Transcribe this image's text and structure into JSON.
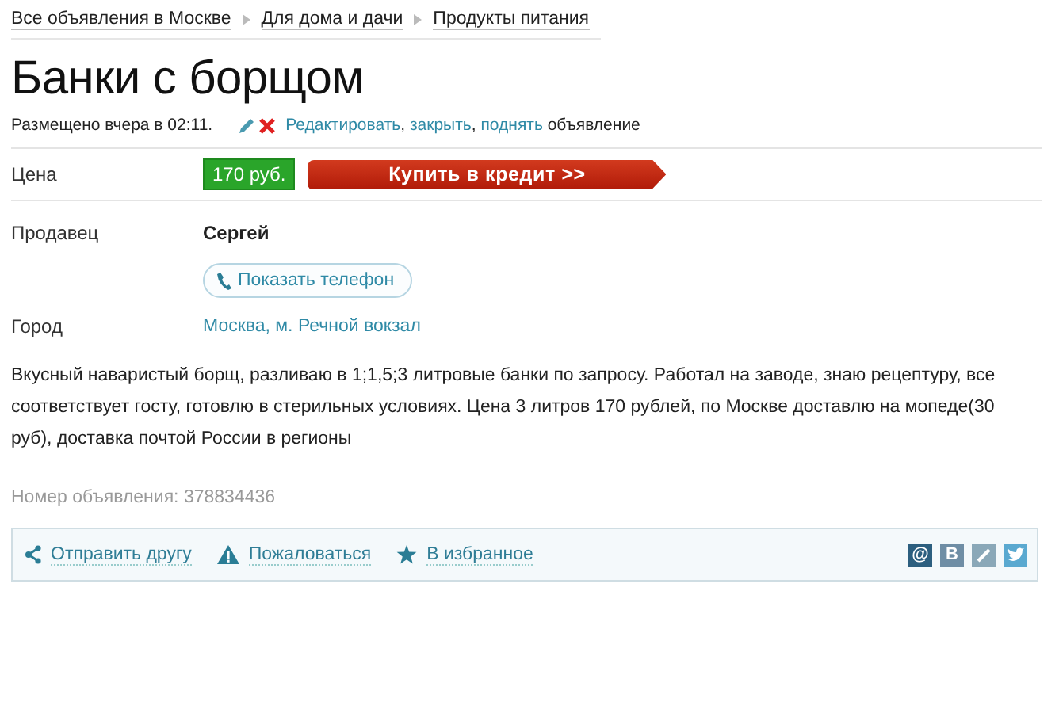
{
  "breadcrumbs": [
    "Все объявления в Москве",
    "Для дома и дачи",
    "Продукты питания"
  ],
  "title": "Банки с борщом",
  "posted": "Размещено вчера в 02:11.",
  "actions": {
    "links": [
      "Редактировать",
      "закрыть",
      "поднять"
    ],
    "separator": ", ",
    "suffix": "объявление"
  },
  "price": {
    "label": "Цена",
    "value": "170 руб.",
    "credit_button": "Купить в кредит >>"
  },
  "seller": {
    "label": "Продавец",
    "name": "Сергей",
    "phone_button": "Показать телефон"
  },
  "city": {
    "label": "Город",
    "value": "Москва, м. Речной вокзал"
  },
  "description": "Вкусный наваристый борщ, разливаю в 1;1,5;3 литровые банки по запросу. Работал на заводе, знаю рецептуру, все соответствует госту, готовлю в стерильных условиях. Цена 3 литров 170 рублей, по Москве доставлю на мопеде(30 руб), доставка почтой России в регионы",
  "ad_number": "Номер объявления: 378834436",
  "footer": {
    "links": [
      {
        "kind": "share",
        "text": "Отправить другу"
      },
      {
        "kind": "report",
        "text": "Пожаловаться"
      },
      {
        "kind": "favorite",
        "text": "В избранное"
      }
    ],
    "social": [
      {
        "kind": "mail",
        "glyph": "@"
      },
      {
        "kind": "vk",
        "glyph": "B"
      },
      {
        "kind": "ok"
      },
      {
        "kind": "twitter"
      }
    ]
  }
}
